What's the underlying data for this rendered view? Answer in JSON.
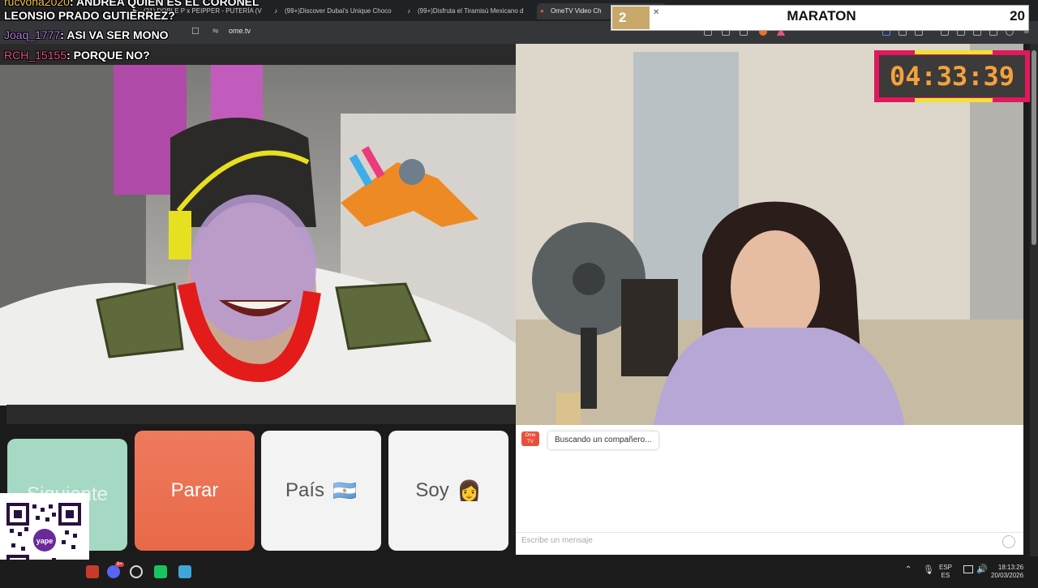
{
  "browser": {
    "tabs": [
      {
        "label": "(21) DOBLE P x PEIPPER - PUTERÍA (V",
        "icon": "youtube-icon"
      },
      {
        "label": "(99+)Discover Dubai's Unique Choco",
        "icon": "tiktok-icon"
      },
      {
        "label": "(99+)Disfruta el Tiramisú Mexicano d",
        "icon": "tiktok-icon"
      },
      {
        "label": "OmeTV Video Ch",
        "icon": "ometv-icon",
        "active": true
      }
    ],
    "new_tab": "+",
    "url": "ome.tv"
  },
  "chat_overlay": [
    {
      "user": "Joaq_1777",
      "text": ": ASI VA SER MONO",
      "color": "#b57bd8"
    },
    {
      "user": "RCH_15155",
      "text": ": PORQUE NO?",
      "color": "#e0557a"
    }
  ],
  "chat_overlay_top": "LEONSIO PRADO GUTIERREZ?",
  "chat_overlay_cut": ": ANDREA QUIEN ES EL CORONEL",
  "maraton": {
    "left_number": "2",
    "title": "MARATON",
    "right_number": "20"
  },
  "timer": {
    "value": "04:33:39"
  },
  "buttons": {
    "next": "Siguiente",
    "stop": "Parar",
    "country": "País",
    "country_flag": "🇦🇷",
    "soy": "Soy",
    "soy_emoji": "👩"
  },
  "chat": {
    "logo_text": "Ome TV",
    "status": "Buscando un compañero...",
    "placeholder": "Escribe un mensaje"
  },
  "qr": {
    "brand": "yape"
  },
  "taskbar": {
    "lang_top": "ESP",
    "lang_bottom": "ES",
    "time": "18:13:26",
    "date": "20/03/2026",
    "discord_badge": "9+"
  },
  "colors": {
    "accent_timer": "#e0185d",
    "timer_digits": "#f3a23d",
    "stop_button": "#e86948",
    "next_button": "#a6d9c4"
  }
}
